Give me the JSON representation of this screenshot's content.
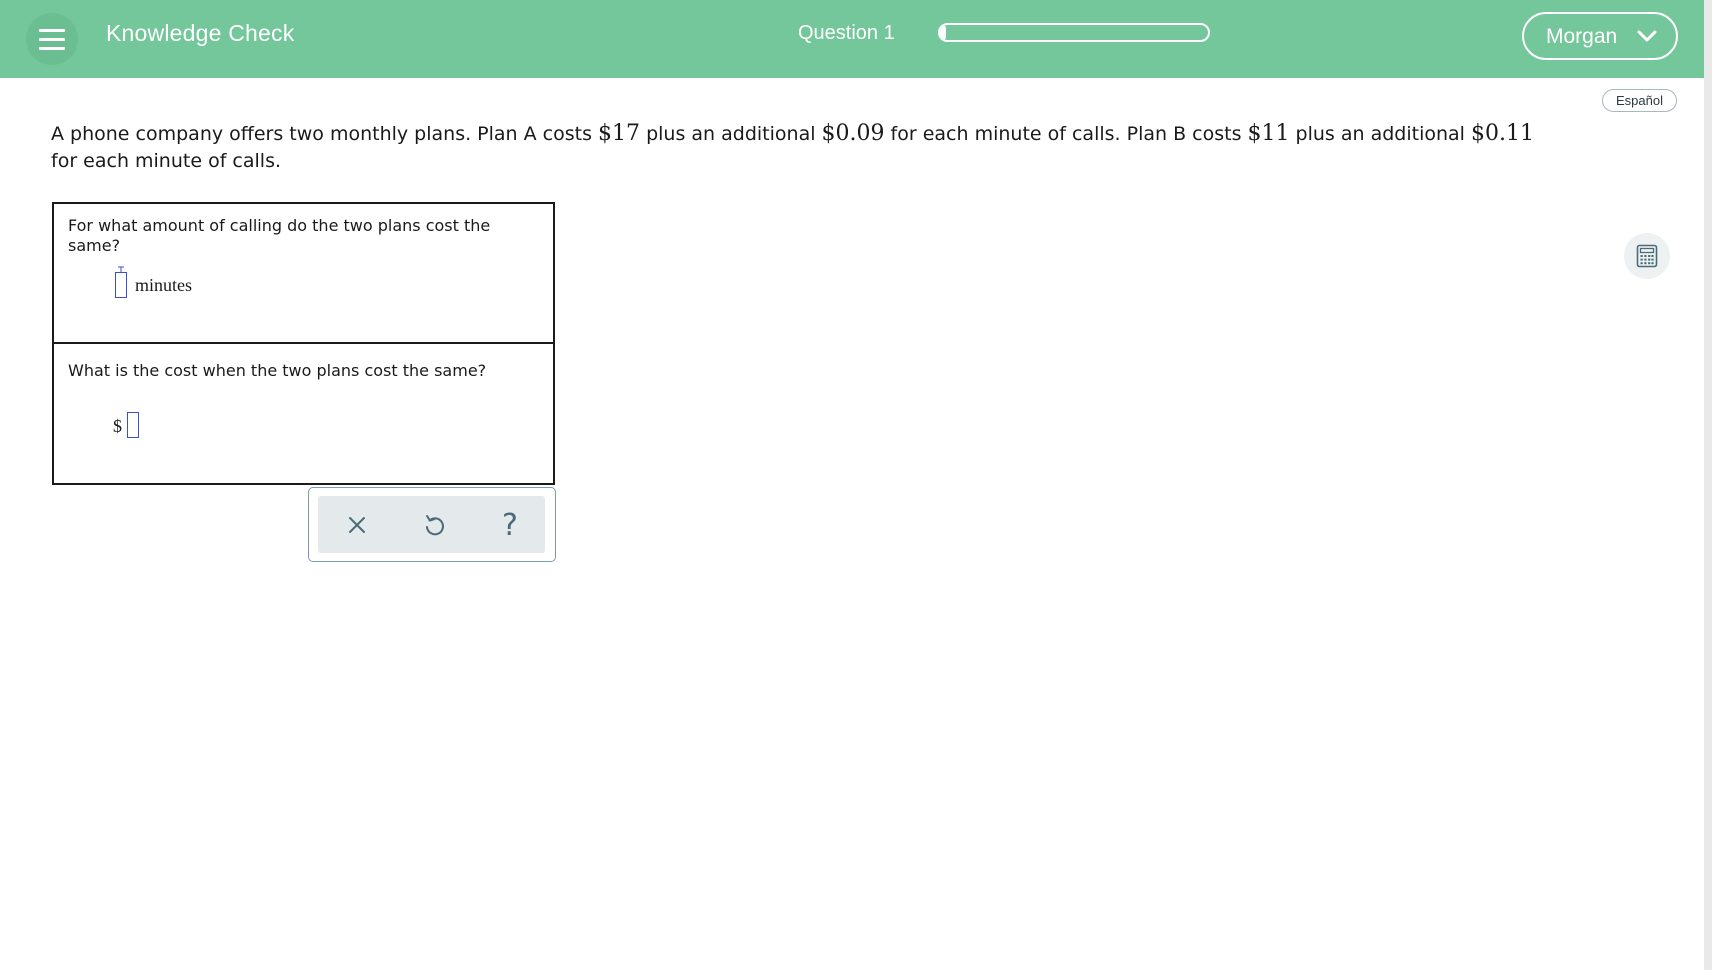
{
  "header": {
    "app_title": "Knowledge Check",
    "question_label": "Question 1",
    "progress_fraction": 0.02,
    "user_name": "Morgan",
    "background_color": "#74c69b"
  },
  "language_button": "Español",
  "problem": {
    "t1": "A phone company offers two monthly plans. Plan A costs ",
    "m1": "$17",
    "t2": " plus an additional ",
    "m2": "$0.09",
    "t3": " for each minute of calls. Plan B costs ",
    "m3": "$11",
    "t4": " plus an additional ",
    "m4": "$0.11",
    "t5": " for each minute of calls."
  },
  "part1": {
    "question": "For what amount of calling do the two plans cost the same?",
    "answer_value": "",
    "unit": "minutes"
  },
  "part2": {
    "question": "What is the cost when the two plans cost the same?",
    "prefix": "$",
    "answer_value": ""
  },
  "toolbar": {
    "clear_icon": "close-icon",
    "undo_icon": "undo-icon",
    "help_label": "?"
  },
  "icons": {
    "menu": "menu-icon",
    "calculator": "calculator-icon",
    "user_menu": "chevron-down-icon"
  },
  "colors": {
    "answer_box_border": "#3a4fd6",
    "toolbar_border": "#7aa0ad"
  }
}
